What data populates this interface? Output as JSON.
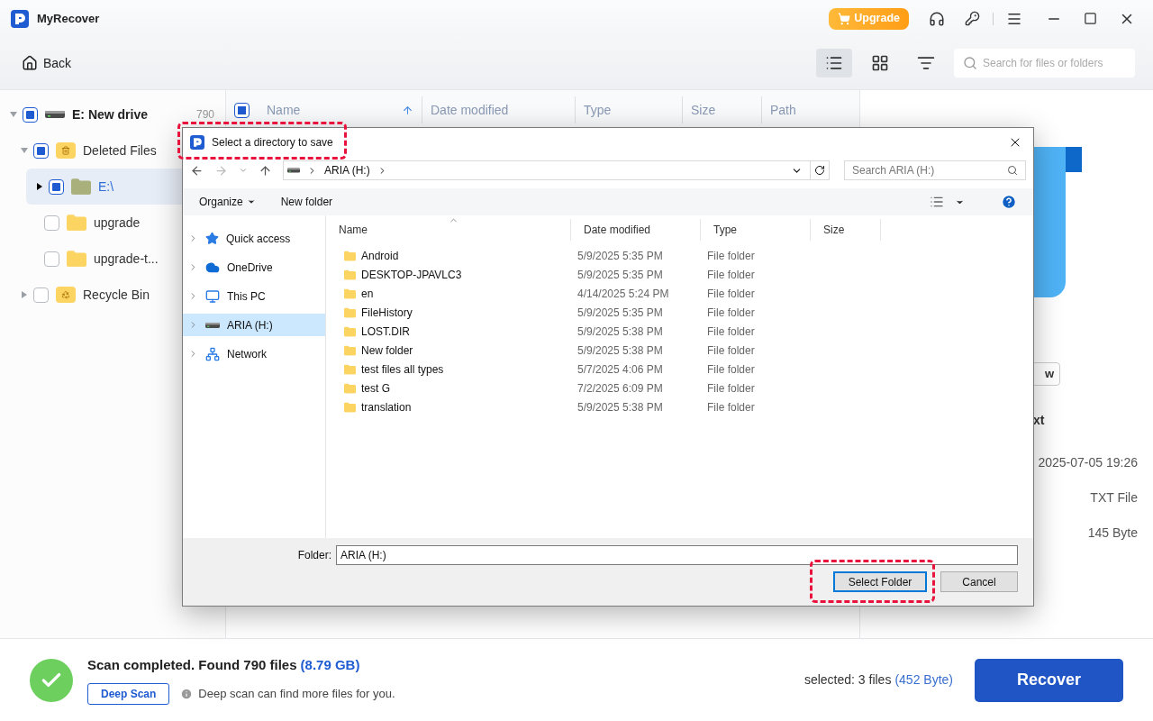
{
  "app": {
    "title": "MyRecover",
    "upgrade": "Upgrade"
  },
  "toolbar": {
    "back": "Back",
    "views": [
      {
        "kind": "list",
        "selected": true
      },
      {
        "kind": "grid",
        "selected": false
      },
      {
        "kind": "filter",
        "selected": false
      }
    ],
    "search": {
      "placeholder": "Search for files or folders"
    }
  },
  "tree": [
    {
      "label": "E: New drive",
      "count": "790",
      "kind": "drive",
      "checked": true,
      "expanded": true,
      "selected": false,
      "children": [
        {
          "label": "Deleted Files",
          "kind": "trash",
          "checked": true,
          "expanded": true,
          "selected": false,
          "children": [
            {
              "label": "E:\\",
              "kind": "folder",
              "checked": true,
              "expanded": false,
              "selected": true
            },
            {
              "label": "upgrade",
              "kind": "folder",
              "checked": false,
              "selected": false
            },
            {
              "label": "upgrade-t...",
              "kind": "folder",
              "checked": false,
              "selected": false
            }
          ]
        },
        {
          "label": "Recycle Bin",
          "kind": "recycle",
          "checked": false,
          "expanded": false,
          "selected": false
        }
      ]
    }
  ],
  "file_list": {
    "checked": true,
    "columns": [
      "Name",
      "Date modified",
      "Type",
      "Size",
      "Path"
    ]
  },
  "preview": {
    "button": "w",
    "name": "xt",
    "details": [
      "2025-07-05 19:26",
      "TXT File",
      "145 Byte"
    ]
  },
  "dialog": {
    "title": "Select a directory to save",
    "title_highlighted": true,
    "address": {
      "path": "ARIA (H:)",
      "search_placeholder": "Search ARIA (H:)"
    },
    "commands": {
      "organize": "Organize",
      "new_folder": "New folder"
    },
    "nav": [
      {
        "label": "Quick access",
        "kind": "star",
        "selected": false
      },
      {
        "label": "OneDrive",
        "kind": "cloud",
        "selected": false
      },
      {
        "label": "This PC",
        "kind": "pc",
        "selected": false
      },
      {
        "label": "ARIA (H:)",
        "kind": "drive",
        "selected": true
      },
      {
        "label": "Network",
        "kind": "network",
        "selected": false
      }
    ],
    "columns": [
      "Name",
      "Date modified",
      "Type",
      "Size"
    ],
    "rows": [
      {
        "name": "Android",
        "date": "5/9/2025 5:35 PM",
        "type": "File folder"
      },
      {
        "name": "DESKTOP-JPAVLC3",
        "date": "5/9/2025 5:35 PM",
        "type": "File folder"
      },
      {
        "name": "en",
        "date": "4/14/2025 5:24 PM",
        "type": "File folder"
      },
      {
        "name": "FileHistory",
        "date": "5/9/2025 5:35 PM",
        "type": "File folder"
      },
      {
        "name": "LOST.DIR",
        "date": "5/9/2025 5:38 PM",
        "type": "File folder"
      },
      {
        "name": "New folder",
        "date": "5/9/2025 5:38 PM",
        "type": "File folder"
      },
      {
        "name": "test files all types",
        "date": "5/7/2025 4:06 PM",
        "type": "File folder"
      },
      {
        "name": "test G",
        "date": "7/2/2025 6:09 PM",
        "type": "File folder"
      },
      {
        "name": "translation",
        "date": "5/9/2025 5:38 PM",
        "type": "File folder"
      }
    ],
    "folder_label": "Folder:",
    "folder_value": "ARIA (H:)",
    "select_button": "Select Folder",
    "select_highlighted": true,
    "cancel_button": "Cancel"
  },
  "status": {
    "message": "Scan completed. Found 790 files",
    "size": "(8.79 GB)",
    "deep_scan": "Deep Scan",
    "hint": "Deep scan can find more files for you.",
    "selected": "selected: 3 files",
    "selected_size": "(452 Byte)",
    "recover": "Recover"
  }
}
